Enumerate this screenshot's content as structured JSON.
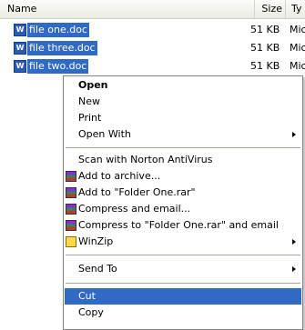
{
  "columns": {
    "name": "Name",
    "size": "Size",
    "type": "Ty"
  },
  "files": [
    {
      "name": "file one.doc",
      "size": "51 KB",
      "type": "Mic",
      "icon": "word-doc-icon"
    },
    {
      "name": "file three.doc",
      "size": "51 KB",
      "type": "Mic",
      "icon": "word-doc-icon"
    },
    {
      "name": "file two.doc",
      "size": "51 KB",
      "type": "Mic",
      "icon": "word-doc-icon"
    }
  ],
  "menu": {
    "open": "Open",
    "new": "New",
    "print": "Print",
    "open_with": "Open With",
    "scan": "Scan with Norton AntiVirus",
    "add_archive": "Add to archive...",
    "add_rar": "Add to \"Folder One.rar\"",
    "compress_email": "Compress and email...",
    "compress_rar_email": "Compress to \"Folder One.rar\" and email",
    "winzip": "WinZip",
    "send_to": "Send To",
    "cut": "Cut",
    "copy": "Copy"
  },
  "colors": {
    "selection": "#316ac5"
  }
}
